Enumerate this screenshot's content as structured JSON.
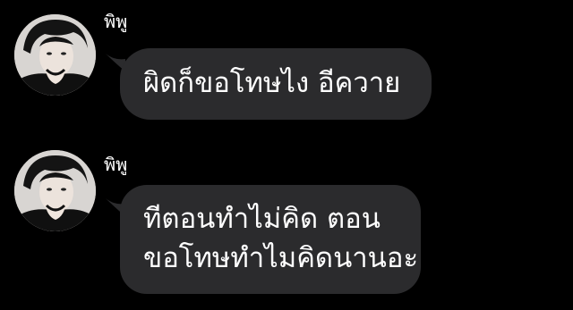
{
  "conversation": {
    "messages": [
      {
        "sender": "พิพู",
        "avatar_icon": "profile-photo-icon",
        "text_lines": [
          "ผิดก็ขอโทษไง อีควาย"
        ]
      },
      {
        "sender": "พิพู",
        "avatar_icon": "profile-photo-icon",
        "text_lines": [
          "ทีตอนทำไม่คิด ตอน",
          "ขอโทษทำไมคิดนานอะ"
        ]
      }
    ]
  },
  "colors": {
    "background": "#000000",
    "bubble": "#2b2b2d",
    "text": "#ffffff"
  }
}
